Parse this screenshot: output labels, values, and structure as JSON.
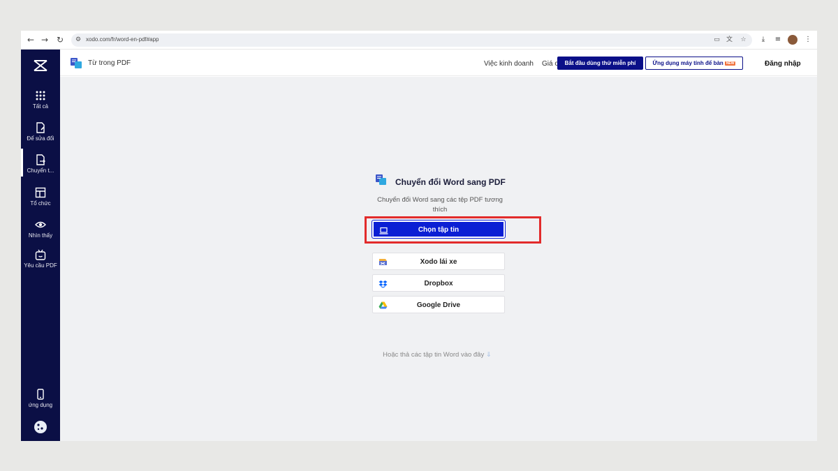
{
  "browser": {
    "url": "xodo.com/fr/word-en-pdf#app",
    "back_icon": "arrow-left-icon",
    "forward_icon": "arrow-right-icon",
    "reload_icon": "reload-icon"
  },
  "sidebar": {
    "items": [
      {
        "label": "Tất cả",
        "icon": "grid-icon"
      },
      {
        "label": "Để sửa đổi",
        "icon": "edit-document-icon"
      },
      {
        "label": "Chuyển t...",
        "icon": "convert-document-icon"
      },
      {
        "label": "Tổ chức",
        "icon": "layout-icon"
      },
      {
        "label": "Nhìn thấy",
        "icon": "eye-icon"
      },
      {
        "label": "Yêu cầu PDF",
        "icon": "bot-icon"
      }
    ],
    "bottom_items": [
      {
        "label": "ứng dụng",
        "icon": "phone-icon"
      }
    ]
  },
  "header": {
    "title": "Từ trong PDF",
    "links": [
      "Việc kinh doanh",
      "Giá cả"
    ],
    "cta_primary": "Bắt đầu dùng thử miễn phí",
    "cta_secondary": "Ứng dụng máy tính để bàn",
    "new_badge": "NEW",
    "login": "Đăng nhập"
  },
  "converter": {
    "title": "Chuyển đổi Word sang PDF",
    "description": "Chuyển đổi Word sang các tệp PDF tương thích",
    "options": [
      {
        "label": "Chọn tập tin",
        "icon": "laptop-icon"
      },
      {
        "label": "Xodo lái xe",
        "icon": "xodo-drive-icon"
      },
      {
        "label": "Dropbox",
        "icon": "dropbox-icon"
      },
      {
        "label": "Google Drive",
        "icon": "google-drive-icon"
      }
    ],
    "drop_hint": "Hoặc thả các tập tin Word vào đây"
  },
  "colors": {
    "sidebar_bg": "#0b0f45",
    "primary": "#0b1fd4",
    "highlight": "#e22b2b",
    "cta_bg": "#0a0f88"
  }
}
